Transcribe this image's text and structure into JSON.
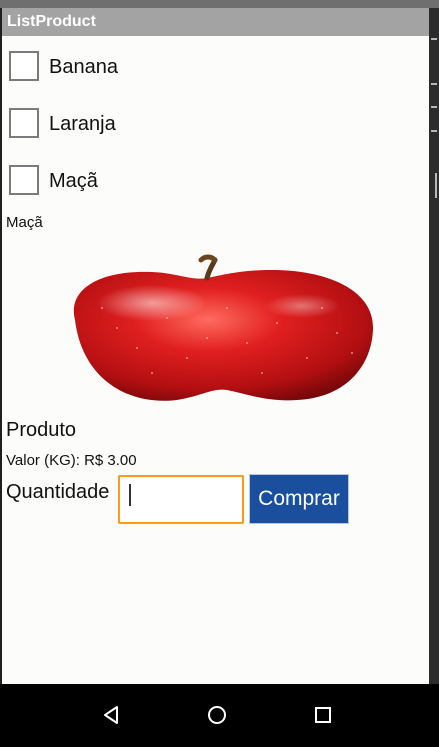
{
  "app": {
    "title": "ListProduct"
  },
  "products": [
    {
      "label": "Banana",
      "checked": false
    },
    {
      "label": "Laranja",
      "checked": false
    },
    {
      "label": "Maçã",
      "checked": false
    }
  ],
  "details": {
    "selected_name": "Maçã",
    "image_icon": "red-apple",
    "product_heading": "Produto",
    "price_text": "Valor (KG): R$ 3.00",
    "quantity_label": "Quantidade",
    "quantity_value": "",
    "buy_label": "Comprar"
  },
  "navigation": {
    "back_icon": "back-triangle-icon",
    "home_icon": "home-circle-icon",
    "recents_icon": "recents-square-icon"
  },
  "colors": {
    "title_bar": "#a3a3a3",
    "input_focus_border": "#ff9a1a",
    "button_bg": "#1a4f9e",
    "nav_bar": "#000000"
  }
}
